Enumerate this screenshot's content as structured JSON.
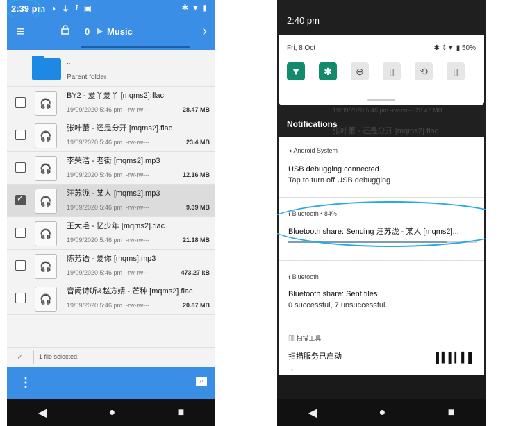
{
  "left": {
    "status": {
      "time": "2:39 pm",
      "icons": [
        "android-debug-icon",
        "usb-icon",
        "upload-icon",
        "image-icon"
      ],
      "right_icons": [
        "bluetooth-icon",
        "wifi-icon",
        "battery-icon"
      ]
    },
    "appbar": {
      "count": "0",
      "folder": "Music"
    },
    "parent": {
      "dots": "..",
      "label": "Parent folder"
    },
    "files": [
      {
        "name": "BY2 - 爱丫爱丫 [mqms2].flac",
        "date": "19/09/2020 5:46 pm",
        "perm": "-rw-rw---",
        "size": "28.47 MB",
        "selected": false
      },
      {
        "name": "张叶蕾 - 还是分开 [mqms2].flac",
        "date": "19/09/2020 5:46 pm",
        "perm": "-rw-rw---",
        "size": "23.4 MB",
        "selected": false
      },
      {
        "name": "李荣浩 - 老街 [mqms2].mp3",
        "date": "19/09/2020 5:46 pm",
        "perm": "-rw-rw---",
        "size": "12.16 MB",
        "selected": false
      },
      {
        "name": "汪苏泷 - 某人 [mqms2].mp3",
        "date": "19/09/2020 5:46 pm",
        "perm": "-rw-rw---",
        "size": "9.39 MB",
        "selected": true
      },
      {
        "name": "王大毛 - 忆少年 [mqms2].flac",
        "date": "19/09/2020 5:46 pm",
        "perm": "-rw-rw---",
        "size": "21.18 MB",
        "selected": false
      },
      {
        "name": "陈芳语 - 爱你 [mqms].mp3",
        "date": "19/09/2020 5:46 pm",
        "perm": "-rw-rw---",
        "size": "473.27 kB",
        "selected": false
      },
      {
        "name": "音阙诗听&赵方婧 - 芒种 [mqms2].flac",
        "date": "19/09/2020 5:46 pm",
        "perm": "-rw-rw---",
        "size": "20.87 MB",
        "selected": false
      }
    ],
    "selection_text": "1 file selected.",
    "nav": {
      "back": "◀",
      "home": "●",
      "recent": "■"
    }
  },
  "right": {
    "time": "2:40 pm",
    "date": "Fri, 8 Oct",
    "status_right": "✱ ⇕▼ ▮ 50%",
    "tiles": [
      {
        "icon": "wifi-icon",
        "glyph": "▼",
        "on": true
      },
      {
        "icon": "bluetooth-icon",
        "glyph": "✱",
        "on": true
      },
      {
        "icon": "dnd-icon",
        "glyph": "⊖",
        "on": false
      },
      {
        "icon": "flashlight-icon",
        "glyph": "▯",
        "on": false
      },
      {
        "icon": "auto-rotate-icon",
        "glyph": "⟲",
        "on": false
      },
      {
        "icon": "battery-saver-icon",
        "glyph": "▯",
        "on": false
      }
    ],
    "ghost_row": "19/09/2020 5:46 pm  -rw-rw---          28.47 MB",
    "ghost_name": "张叶蕾 - 还是分开 [mqms2].flac",
    "notifications_title": "Notifications",
    "cards": {
      "android": {
        "app": "Android System",
        "title": "USB debugging connected",
        "sub": "Tap to turn off USB debugging"
      },
      "bt_sending": {
        "app": "Bluetooth • 84%",
        "title": "Bluetooth share: Sending 汪苏泷 - 某人 [mqms2]...",
        "progress": 0.84
      },
      "bt_sent": {
        "app": "Bluetooth",
        "title": "Bluetooth share: Sent files",
        "sub": "0 successful, 7 unsuccessful."
      },
      "scan": {
        "app": "扫描工具",
        "title": "扫描服务已启动"
      }
    },
    "nav": {
      "back": "◀",
      "home": "●",
      "recent": "■"
    }
  }
}
